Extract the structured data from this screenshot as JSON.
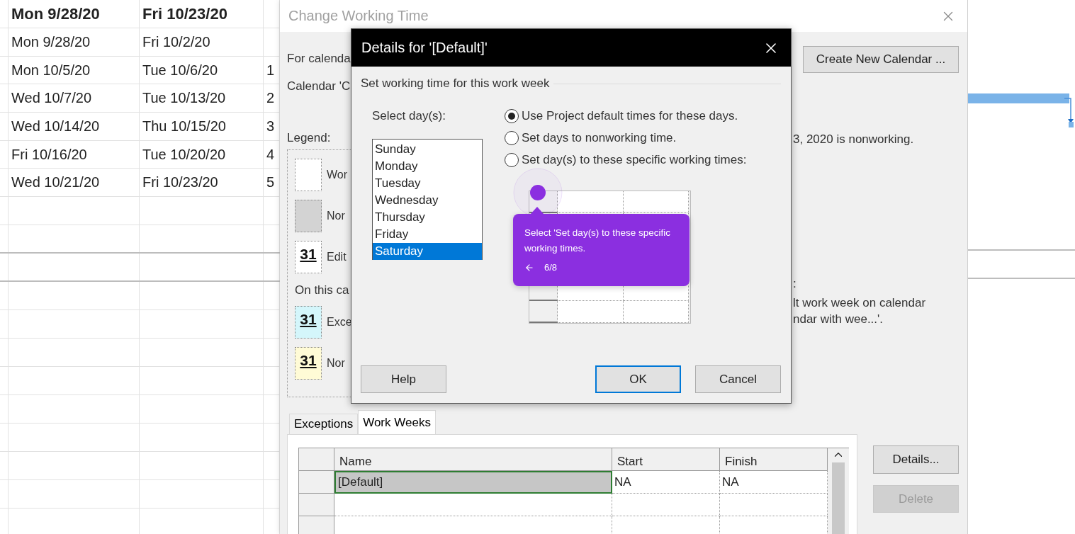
{
  "sheet": {
    "header": [
      "Mon 9/28/20",
      "Fri 10/23/20"
    ],
    "rows": [
      {
        "start": "Mon 9/28/20",
        "finish": "Fri 10/2/20"
      },
      {
        "start": "Mon 10/5/20",
        "finish": "Tue 10/6/20",
        "column_3": "1"
      },
      {
        "start": "Wed 10/7/20",
        "finish": "Tue 10/13/20",
        "column_3": "2"
      },
      {
        "start": "Wed 10/14/20",
        "finish": "Thu 10/15/20",
        "column_3": "3"
      },
      {
        "start": "Fri 10/16/20",
        "finish": "Tue 10/20/20",
        "column_3": "4"
      },
      {
        "start": "Wed 10/21/20",
        "finish": "Fri 10/23/20",
        "column_3": "5"
      }
    ]
  },
  "change_working_time": {
    "title": "Change Working Time",
    "for_calendar_label": "For calenda",
    "calendar_note": "Calendar 'C",
    "legend_label": "Legend:",
    "legend": [
      {
        "kind": "working",
        "label": "Wor"
      },
      {
        "kind": "nonworking",
        "label": "Nor"
      },
      {
        "kind": "edited",
        "day": "31",
        "label": "Edit"
      }
    ],
    "on_this_calendar_label": "On this ca",
    "calendar_legend": [
      {
        "kind": "exception",
        "day": "31",
        "label": "Exce"
      },
      {
        "kind": "nondefault",
        "day": "31",
        "label": "Nor"
      }
    ],
    "create_button": "Create New Calendar ...",
    "nonworking_note": "3, 2020 is nonworking.",
    "week_heading": ":",
    "week_note_lines": [
      "lt work week on calendar",
      "ndar with wee...'."
    ],
    "tabs": [
      {
        "label": "Exceptions",
        "selected": false
      },
      {
        "label": "Work Weeks",
        "selected": true
      }
    ],
    "work_weeks": {
      "columns": [
        "Name",
        "Start",
        "Finish"
      ],
      "rows": [
        {
          "name": "[Default]",
          "start": "NA",
          "finish": "NA",
          "selected": true
        }
      ]
    },
    "details_button": {
      "label": "Details...",
      "disabled": false
    },
    "delete_button": {
      "label": "Delete",
      "disabled": true
    }
  },
  "details": {
    "title": "Details for '[Default]'",
    "section": "Set working time for this work week",
    "select_label": "Select day(s):",
    "days": [
      {
        "label": "Sunday",
        "selected": false
      },
      {
        "label": "Monday",
        "selected": false
      },
      {
        "label": "Tuesday",
        "selected": false
      },
      {
        "label": "Wednesday",
        "selected": false
      },
      {
        "label": "Thursday",
        "selected": false
      },
      {
        "label": "Friday",
        "selected": false
      },
      {
        "label": "Saturday",
        "selected": true
      }
    ],
    "options": [
      {
        "label": "Use Project default times for these days.",
        "selected": true
      },
      {
        "label": "Set days to nonworking time.",
        "selected": false
      },
      {
        "label": "Set day(s) to these specific working times:",
        "selected": false
      }
    ],
    "buttons": [
      {
        "label": "Help",
        "default": false
      },
      {
        "label": "OK",
        "default": true
      },
      {
        "label": "Cancel",
        "default": false
      }
    ]
  },
  "tooltip": {
    "text": "Select 'Set day(s) to these specific working times.",
    "step": "6/8"
  }
}
